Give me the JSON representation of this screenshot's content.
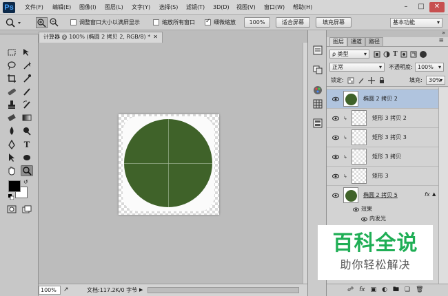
{
  "app": {
    "logo": "Ps"
  },
  "menubar": {
    "items": [
      "文件(F)",
      "编辑(E)",
      "图像(I)",
      "图层(L)",
      "文字(Y)",
      "选择(S)",
      "滤镜(T)",
      "3D(D)",
      "视图(V)",
      "窗口(W)",
      "帮助(H)"
    ]
  },
  "options_bar": {
    "resize_windows_label": "调整窗口大小以满屏显示",
    "zoom_all_label": "缩放所有窗口",
    "scrubby_zoom_label": "细微缩放",
    "zoom_value": "100%",
    "fit_screen_label": "适合屏幕",
    "fill_screen_label": "填充屏幕",
    "workspace": "基本功能"
  },
  "document": {
    "tab_title": "计算器 @ 100% (椭圆 2 拷贝 2, RGB/8) *",
    "zoom": "100%",
    "status": "文档:117.2K/0 字节",
    "circle_color": "#3f6229"
  },
  "layers_panel": {
    "tabs": [
      "图层",
      "通道",
      "路径"
    ],
    "kind_filter": "ρ 类型",
    "blend_mode": "正常",
    "opacity_label": "不透明度:",
    "opacity_value": "100%",
    "lock_label": "锁定:",
    "fill_label": "填充:",
    "fill_value": "30%",
    "layers": [
      {
        "name": "椭圆 2 拷贝 2",
        "selected": true
      },
      {
        "name": "矩形 3 拷贝 2",
        "selected": false
      },
      {
        "name": "矩形 3 拷贝 3",
        "selected": false
      },
      {
        "name": "矩形 3 拷贝",
        "selected": false
      },
      {
        "name": "矩形 3",
        "selected": false
      },
      {
        "name": "椭圆 2 拷贝 5",
        "selected": false,
        "fx": "fx"
      }
    ],
    "effects_label": "效果",
    "inner_glow_label": "内发光"
  },
  "watermark": {
    "title": "百科全说",
    "subtitle": "助你轻松解决"
  }
}
